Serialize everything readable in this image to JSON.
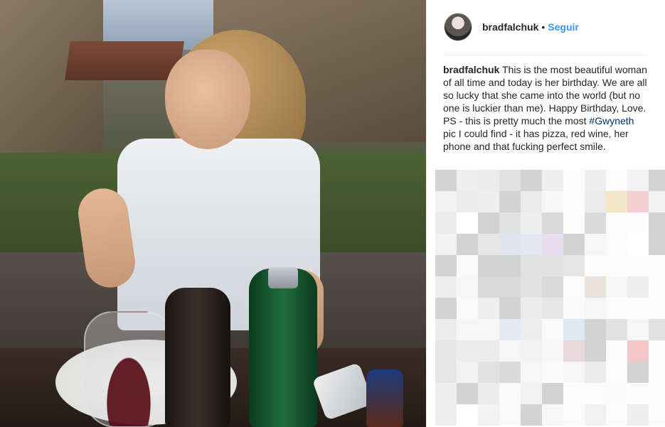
{
  "post": {
    "username": "bradfalchuk",
    "separator": "•",
    "follow_label": "Seguir",
    "caption": {
      "username": "bradfalchuk",
      "text_line1": " This is the most beautiful woman of all time and today is her birthday. We are all so lucky that she came into the world (but no one is luckier than me). Happy Birthday, Love.",
      "text_line2_prefix": "PS - this is pretty much the most ",
      "hashtag": "#Gwyneth",
      "text_line2_suffix": " pic I could find - it has pizza, red wine, her phone and that fucking perfect smile."
    }
  },
  "colors": {
    "link_blue": "#3897f0",
    "hashtag_blue": "#003569",
    "text": "#262626",
    "border": "#efefef"
  },
  "icons": {
    "avatar": "profile-photo"
  }
}
